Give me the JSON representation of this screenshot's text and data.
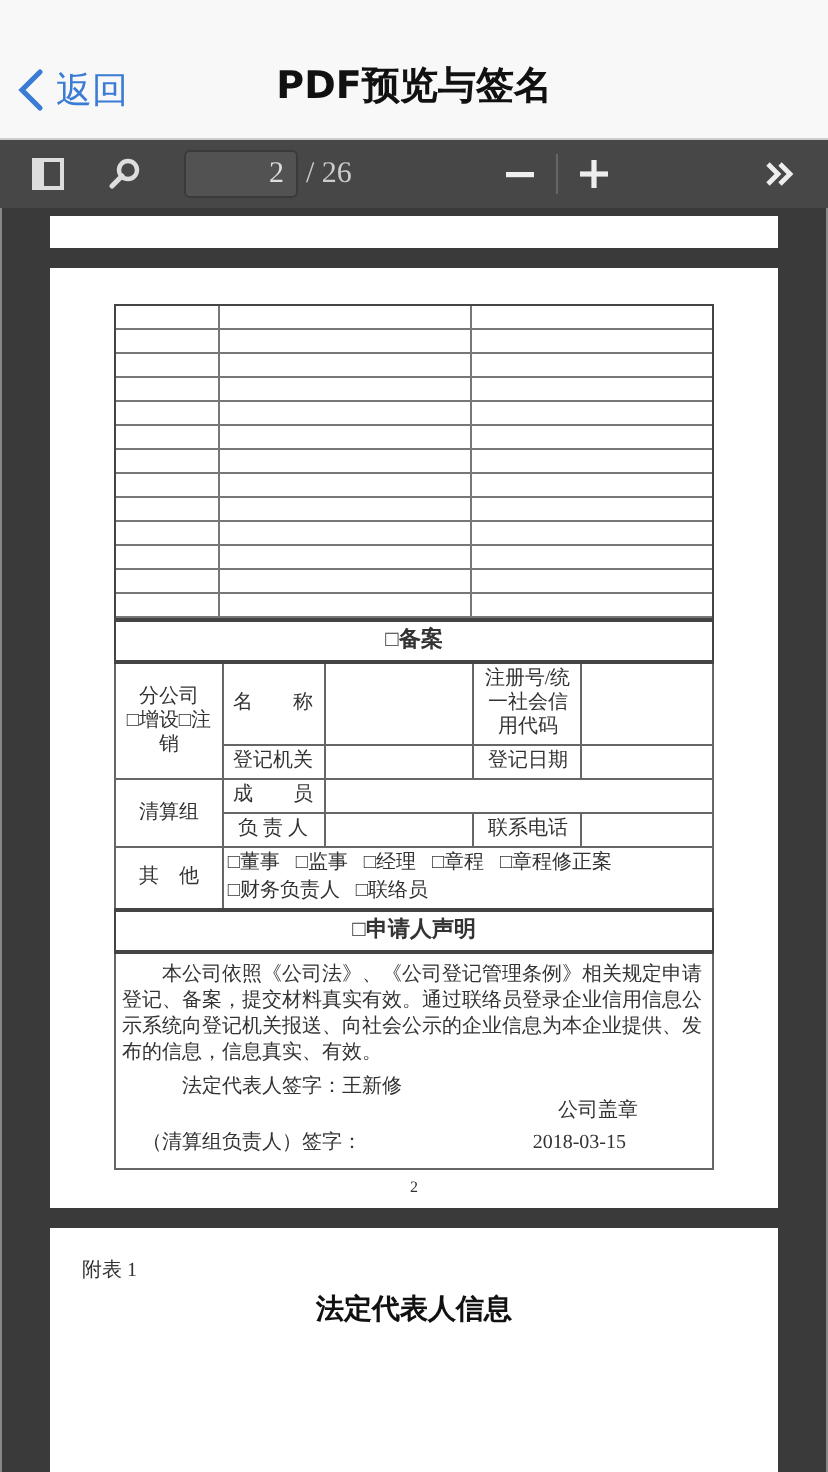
{
  "nav": {
    "back_label": "返回",
    "title": "PDF预览与签名"
  },
  "toolbar": {
    "page_input": "2",
    "page_total": "/ 26"
  },
  "form": {
    "filing_header": "□备案",
    "branch": {
      "label": "分公司",
      "options": "□增设□注销",
      "name_label": "名　　称",
      "reg_label": "注册号/统一社会信用代码",
      "authority_label": "登记机关",
      "date_label": "登记日期"
    },
    "liquidation": {
      "label": "清算组",
      "members_label": "成　　员",
      "leader_label": "负 责 人",
      "phone_label": "联系电话"
    },
    "other": {
      "label": "其　他",
      "options": [
        "□董事",
        "□监事",
        "□经理",
        "□章程",
        "□章程修正案",
        "□财务负责人",
        "□联络员"
      ]
    },
    "declaration_header": "□申请人声明",
    "declaration_text": "本公司依照《公司法》、《公司登记管理条例》相关规定申请登记、备案，提交材料真实有效。通过联络员登录企业信用信息公示系统向登记机关报送、向社会公示的企业信息为本企业提供、发布的信息，信息真实、有效。",
    "legal_rep_signature": "法定代表人签字：王新修",
    "company_seal": "公司盖章",
    "liquidation_signature": "（清算组负责人）签字：",
    "date": "2018-03-15"
  },
  "page_number": "2",
  "next_page": {
    "appendix": "附表 1",
    "title": "法定代表人信息"
  }
}
